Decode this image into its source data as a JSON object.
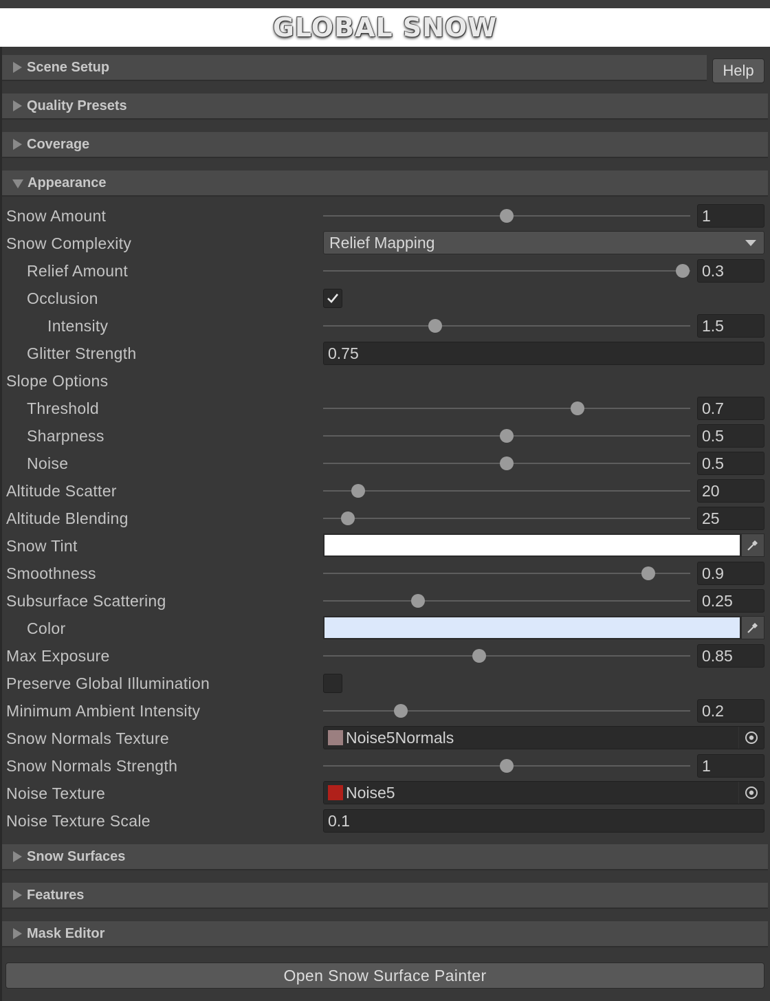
{
  "banner": {
    "logo_text": "GLOBAL SNOW"
  },
  "sections": {
    "scene_setup": "Scene Setup",
    "quality_presets": "Quality Presets",
    "coverage": "Coverage",
    "appearance": "Appearance",
    "snow_surfaces": "Snow Surfaces",
    "features": "Features",
    "mask_editor": "Mask Editor"
  },
  "help_button": "Help",
  "appearance": {
    "snow_amount": {
      "label": "Snow Amount",
      "value": "1",
      "slider_fraction": 0.5
    },
    "snow_complexity": {
      "label": "Snow Complexity",
      "selected": "Relief Mapping"
    },
    "relief_amount": {
      "label": "Relief Amount",
      "value": "0.3",
      "slider_fraction": 0.98
    },
    "occlusion": {
      "label": "Occlusion",
      "checked": true
    },
    "intensity": {
      "label": "Intensity",
      "value": "1.5",
      "slider_fraction": 0.305
    },
    "glitter_strength": {
      "label": "Glitter Strength",
      "value": "0.75"
    },
    "slope_options": {
      "label": "Slope Options"
    },
    "threshold": {
      "label": "Threshold",
      "value": "0.7",
      "slider_fraction": 0.693
    },
    "sharpness": {
      "label": "Sharpness",
      "value": "0.5",
      "slider_fraction": 0.5
    },
    "noise": {
      "label": "Noise",
      "value": "0.5",
      "slider_fraction": 0.5
    },
    "altitude_scatter": {
      "label": "Altitude Scatter",
      "value": "20",
      "slider_fraction": 0.095
    },
    "altitude_blending": {
      "label": "Altitude Blending",
      "value": "25",
      "slider_fraction": 0.067
    },
    "snow_tint": {
      "label": "Snow Tint",
      "color": "#ffffff"
    },
    "smoothness": {
      "label": "Smoothness",
      "value": "0.9",
      "slider_fraction": 0.885
    },
    "subsurface_scattering": {
      "label": "Subsurface Scattering",
      "value": "0.25",
      "slider_fraction": 0.258
    },
    "sss_color": {
      "label": "Color",
      "color": "#dce8fb"
    },
    "max_exposure": {
      "label": "Max Exposure",
      "value": "0.85",
      "slider_fraction": 0.425
    },
    "preserve_gi": {
      "label": "Preserve Global Illumination",
      "checked": false
    },
    "min_ambient": {
      "label": "Minimum Ambient Intensity",
      "value": "0.2",
      "slider_fraction": 0.212
    },
    "normals_texture": {
      "label": "Snow Normals Texture",
      "object": "Noise5Normals",
      "swatch_color": "#9b7f80"
    },
    "normals_strength": {
      "label": "Snow Normals Strength",
      "value": "1",
      "slider_fraction": 0.5
    },
    "noise_texture": {
      "label": "Noise Texture",
      "object": "Noise5",
      "swatch_color": "#b0201a"
    },
    "noise_texture_scale": {
      "label": "Noise Texture Scale",
      "value": "0.1"
    }
  },
  "open_painter_button": "Open Snow Surface Painter"
}
